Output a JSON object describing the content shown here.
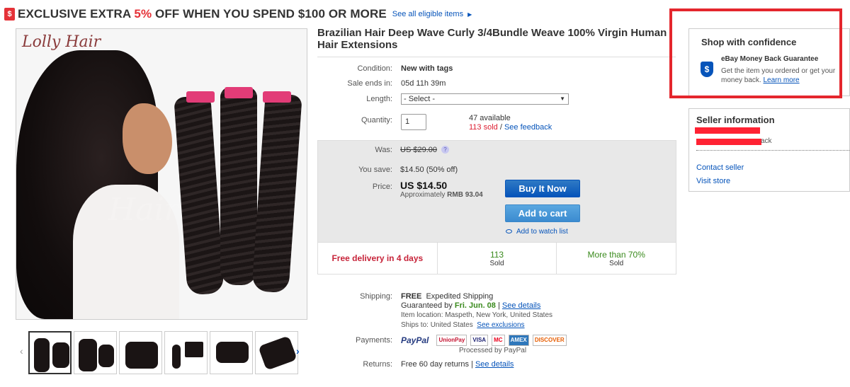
{
  "promo": {
    "icon": "$",
    "text_before": "EXCLUSIVE EXTRA ",
    "percent": "5%",
    "text_after": " OFF WHEN YOU SPEND $100 OR MORE",
    "link": "See all eligible items",
    "arrow": "▶"
  },
  "gallery": {
    "logo": "Lolly Hair",
    "watermark": "Hair",
    "prev": "‹",
    "next": "›",
    "thumbnails": 6
  },
  "listing": {
    "title": "Brazilian Hair Deep Wave Curly 3/4Bundle Weave 100% Virgin Human Hair Extensions",
    "condition_label": "Condition:",
    "condition": "New with tags",
    "sale_ends_label": "Sale ends in:",
    "sale_ends": "05d 11h 39m",
    "length_label": "Length:",
    "length_value": "- Select -",
    "quantity_label": "Quantity:",
    "quantity_value": "1",
    "available": "47 available",
    "sold": "113 sold",
    "sep": " / ",
    "feedback": "See feedback"
  },
  "price": {
    "was_label": "Was:",
    "was": "US $29.00",
    "save_label": "You save:",
    "save": "$14.50 (50% off)",
    "price_label": "Price:",
    "price": "US $14.50",
    "approx_prefix": "Approximately ",
    "approx": "RMB 93.04",
    "buy_now": "Buy It Now",
    "add_to_cart": "Add to cart",
    "watch": "Add to watch list"
  },
  "stats": [
    {
      "line1": "Free delivery in 4 days",
      "line2": ""
    },
    {
      "line1": "113",
      "line2": "Sold"
    },
    {
      "line1": "More than 70%",
      "line2": "Sold"
    }
  ],
  "shipping": {
    "label": "Shipping:",
    "free": "FREE",
    "method": "Expedited Shipping",
    "guaranteed": "Guaranteed by ",
    "date": "Fri. Jun. 08",
    "pipe": " | ",
    "details": "See details",
    "location": "Item location:  Maspeth, New York, United States",
    "ships_to": "Ships to:  United States",
    "exclusions": "See exclusions"
  },
  "payments": {
    "label": "Payments:",
    "paypal": "PayPal",
    "badges": [
      "UnionPay",
      "VISA",
      "MC",
      "AMEX",
      "DISCOVER"
    ],
    "processed": "Processed by PayPal"
  },
  "returns": {
    "label": "Returns:",
    "value": "Free 60 day returns | ",
    "details": "See details"
  },
  "confidence": {
    "title": "Shop with confidence",
    "guarantee": "eBay Money Back Guarantee",
    "desc": "Get the item you ordered or get your money back. ",
    "learn": "Learn more"
  },
  "seller": {
    "title": "Seller information",
    "feedback_tail": "ack",
    "contact": "Contact seller",
    "visit": "Visit store"
  },
  "colors": {
    "accent": "#e53238",
    "link": "#0654ba",
    "green": "#3a8a1d",
    "frame": "#e4262d"
  }
}
